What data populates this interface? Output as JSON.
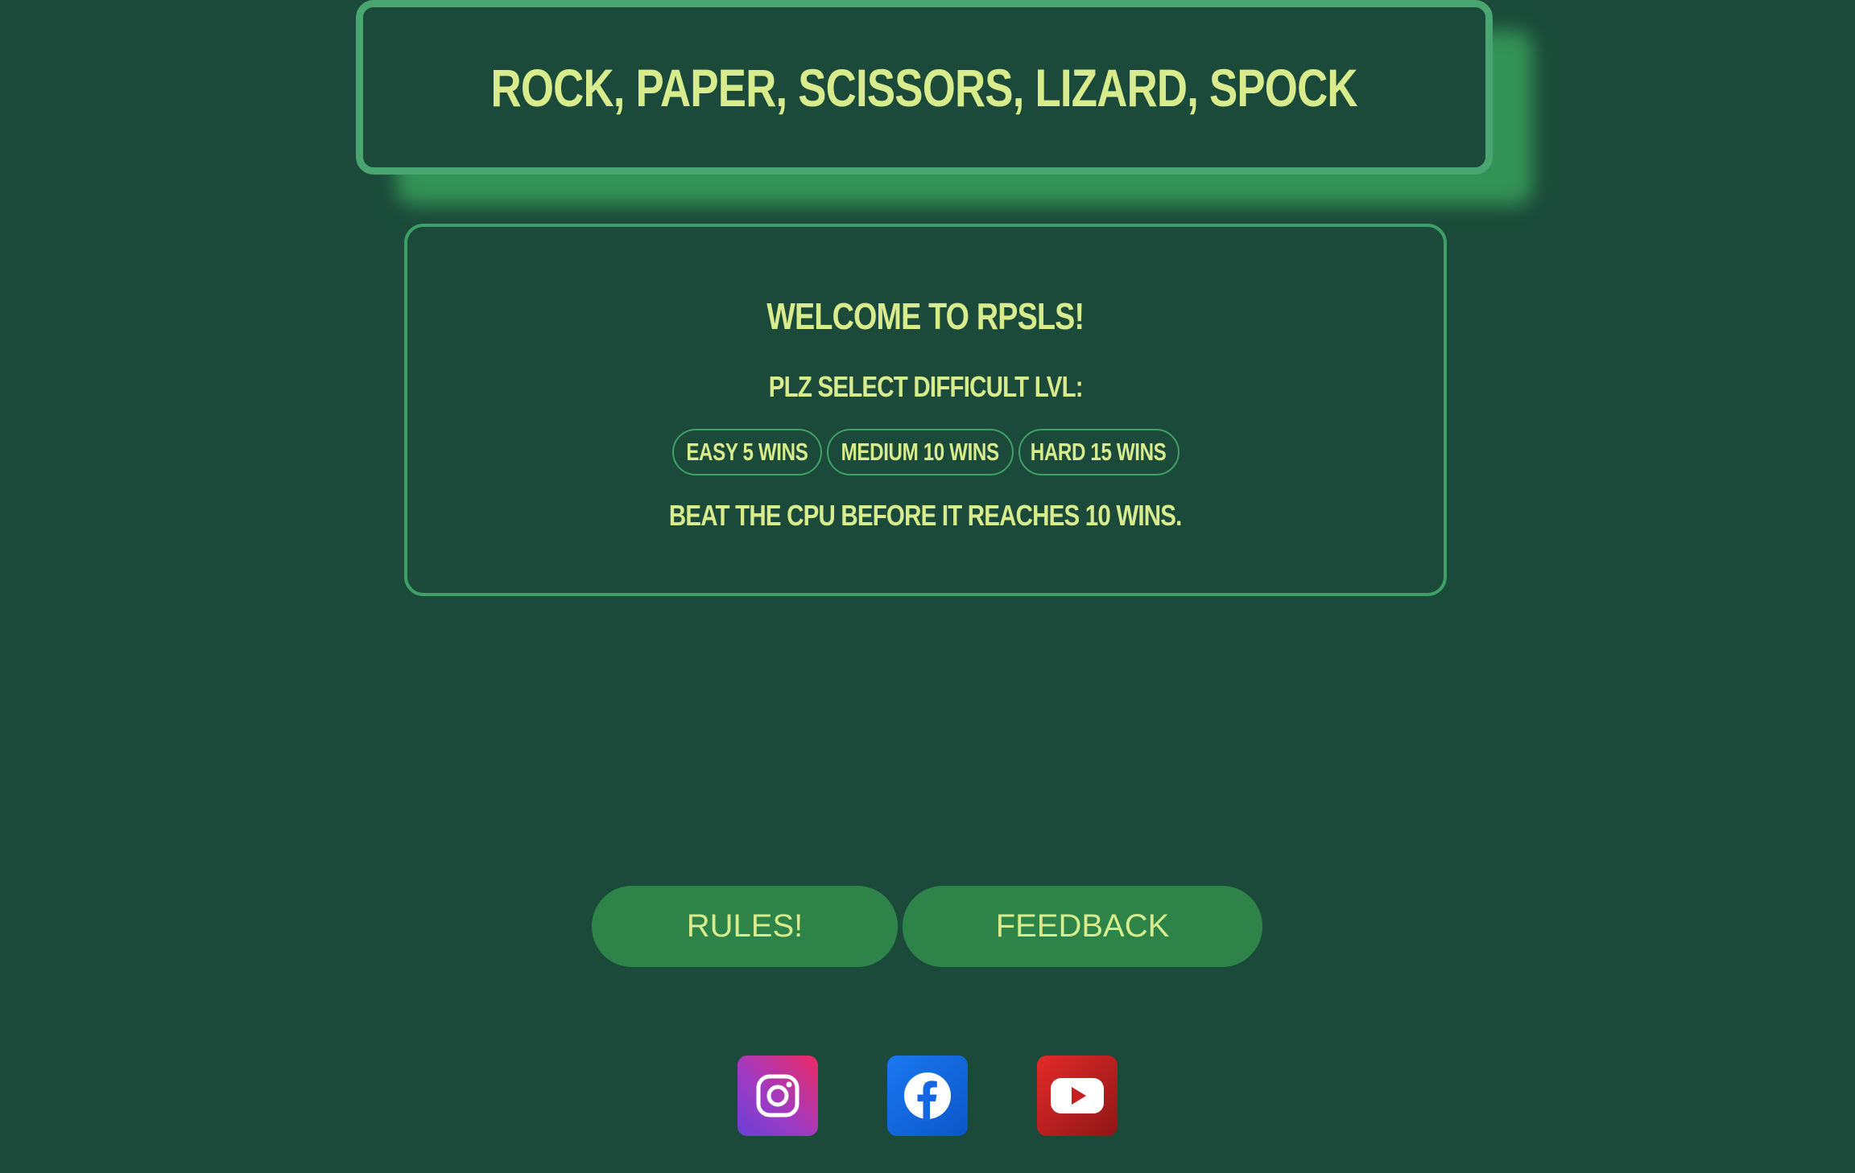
{
  "header": {
    "title": "ROCK, PAPER, SCISSORS, LIZARD, SPOCK"
  },
  "welcome": {
    "heading": "WELCOME TO RPSLS!",
    "select_label": "PLZ SELECT DIFFICULT LVL:",
    "difficulties": [
      {
        "label": "EASY 5 WINS"
      },
      {
        "label": "MEDIUM 10 WINS"
      },
      {
        "label": "HARD 15 WINS"
      }
    ],
    "instruction": "BEAT THE CPU BEFORE IT REACHES 10 WINS."
  },
  "actions": {
    "rules_label": "RULES!",
    "feedback_label": "FEEDBACK"
  },
  "social": [
    {
      "icon": "instagram-icon",
      "color": "#c13584"
    },
    {
      "icon": "facebook-icon",
      "color": "#1877f2"
    },
    {
      "icon": "youtube-icon",
      "color": "#e42a2a"
    }
  ],
  "colors": {
    "background": "#1b4a3a",
    "text": "#d8ec8d",
    "border": "#3fa067",
    "button": "#2e8448"
  }
}
